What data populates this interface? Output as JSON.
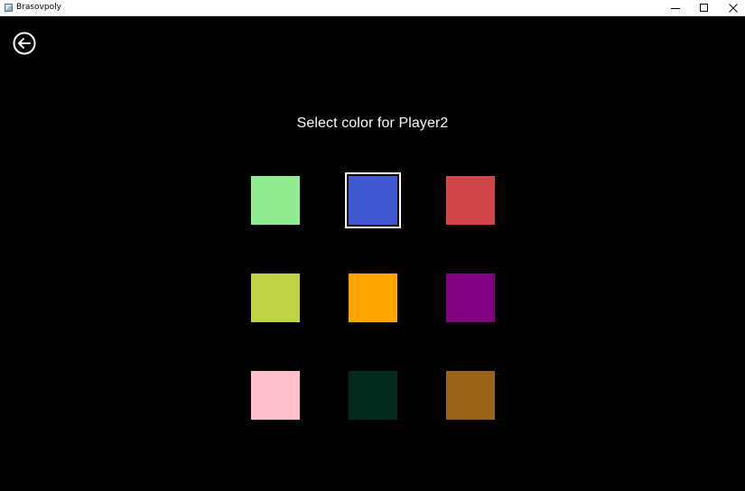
{
  "window": {
    "title": "Brasovpoly",
    "icon": "app-window-icon",
    "controls": [
      "minimize-icon",
      "maximize-icon",
      "close-icon"
    ]
  },
  "screen": {
    "back_icon": "arrow-left-circle-icon",
    "prompt": "Select color for Player2",
    "background": "#000000",
    "selected_index": 1
  },
  "swatches": [
    {
      "color": "#90ee90"
    },
    {
      "color": "#4058d2"
    },
    {
      "color": "#d04545"
    },
    {
      "color": "#c0d345"
    },
    {
      "color": "#ffa500"
    },
    {
      "color": "#800080"
    },
    {
      "color": "#ffc0cb"
    },
    {
      "color": "#012c1b"
    },
    {
      "color": "#9a6418"
    }
  ]
}
